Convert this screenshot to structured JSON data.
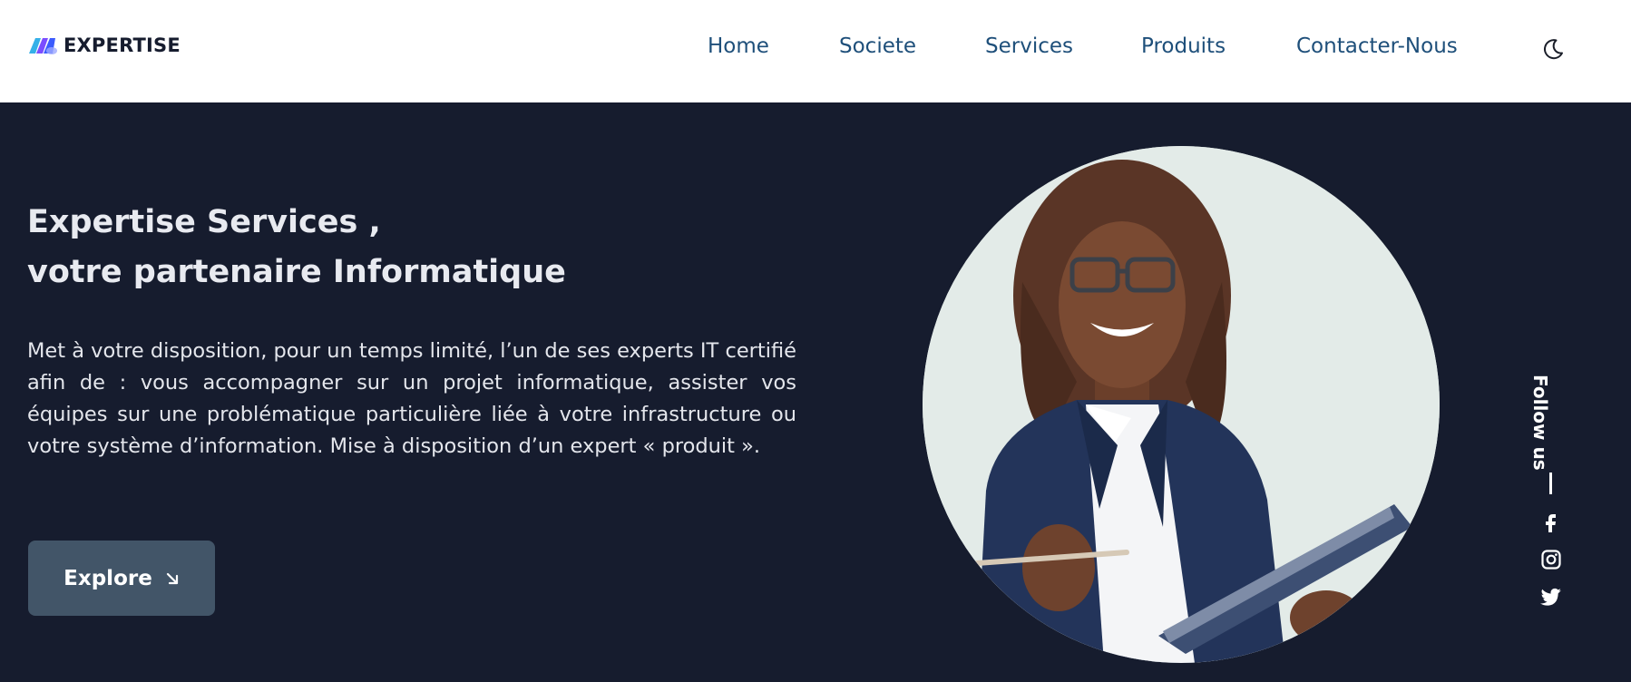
{
  "brand": {
    "name": "EXPERTISE",
    "icon": "expertise-logo-icon",
    "colors": [
      "#3b5bfd",
      "#7b4dff",
      "#35b0e8"
    ]
  },
  "nav": {
    "items": [
      {
        "label": "Home"
      },
      {
        "label": "Societe"
      },
      {
        "label": "Services"
      },
      {
        "label": "Produits"
      },
      {
        "label": "Contacter-Nous"
      }
    ],
    "theme_icon": "moon-icon"
  },
  "hero": {
    "title_line1": "Expertise Services ,",
    "title_line2": "votre partenaire Informatique",
    "description": "Met à votre disposition, pour un temps limité, l’un de ses experts IT certifié afin de : vous accompagner sur un projet informatique, assister vos équipes sur une problématique particulière liée à votre infrastructure ou votre système d’information. Mise à disposition d’un expert « produit ».",
    "cta_label": "Explore",
    "cta_icon": "arrow-down-right-icon"
  },
  "social": {
    "label": "Follow us",
    "icons": [
      "facebook-icon",
      "instagram-icon",
      "twitter-icon"
    ]
  },
  "colors": {
    "background": "#161c2e",
    "nav_text": "#1e4f7a",
    "button": "#425568",
    "header": "#ffffff"
  }
}
